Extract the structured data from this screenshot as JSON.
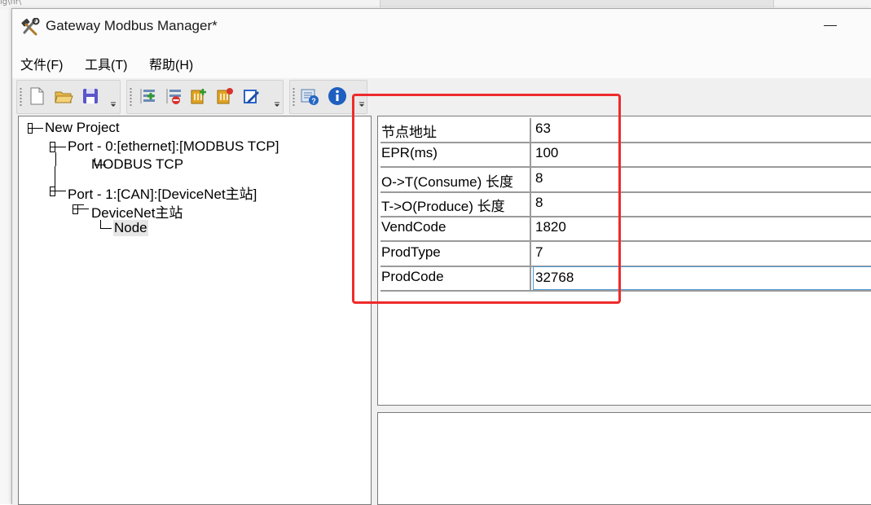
{
  "background": {
    "text": "ig\\fir\\ "
  },
  "window": {
    "title": "Gateway Modbus Manager*",
    "icon": "tools-icon",
    "accent": "#ee2b2b"
  },
  "menu": [
    {
      "label": "文件(F)"
    },
    {
      "label": "工具(T)"
    },
    {
      "label": "帮助(H)"
    }
  ],
  "toolbar": {
    "file_group": [
      "new-file-icon",
      "open-folder-icon",
      "save-icon"
    ],
    "edit_group": [
      "add-port-icon",
      "remove-port-icon",
      "add-device-icon",
      "remove-device-icon",
      "edit-icon"
    ],
    "help_group": [
      "help-icon",
      "info-icon"
    ]
  },
  "tree": {
    "root": "New Project",
    "port0": "Port - 0:[ethernet]:[MODBUS TCP]",
    "port0_child": "MODBUS TCP",
    "port1": "Port - 1:[CAN]:[DeviceNet主站]",
    "port1_child": "DeviceNet主站",
    "node": "Node"
  },
  "properties": [
    {
      "label": "节点地址",
      "value": "63"
    },
    {
      "label": "EPR(ms)",
      "value": "100"
    },
    {
      "label": "O->T(Consume) 长度",
      "value": "8"
    },
    {
      "label": "T->O(Produce) 长度",
      "value": "8"
    },
    {
      "label": "VendCode",
      "value": "1820"
    },
    {
      "label": "ProdType",
      "value": "7"
    },
    {
      "label": "ProdCode",
      "value": "32768"
    }
  ]
}
